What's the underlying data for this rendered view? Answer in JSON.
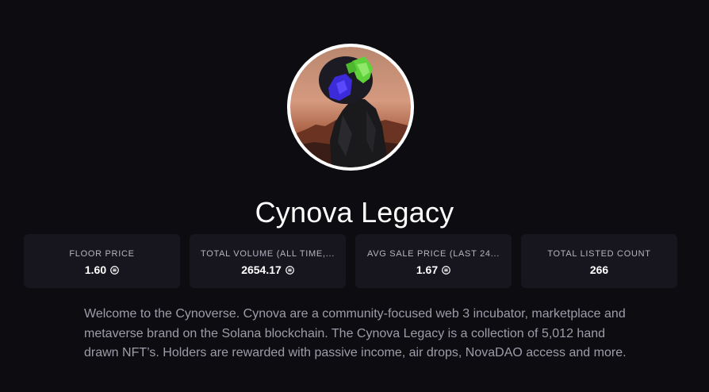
{
  "collection": {
    "name": "Cynova Legacy",
    "avatar_icon": "cynova-avatar-image"
  },
  "stats": [
    {
      "label": "FLOOR PRICE",
      "value": "1.60",
      "currency_icon": "solana-icon"
    },
    {
      "label": "TOTAL VOLUME (ALL TIME,...",
      "value": "2654.17",
      "currency_icon": "solana-icon"
    },
    {
      "label": "AVG SALE PRICE (LAST 24...",
      "value": "1.67",
      "currency_icon": "solana-icon"
    },
    {
      "label": "TOTAL LISTED COUNT",
      "value": "266"
    }
  ],
  "description": "Welcome to the Cynoverse. Cynova are a community-focused web 3 incubator, marketplace and metaverse brand on the Solana blockchain. The Cynova Legacy is a collection of 5,012 hand drawn NFT’s. Holders are rewarded with passive income, air drops, NovaDAO access and more.",
  "colors": {
    "background": "#0d0c10",
    "card": "#17161f",
    "label": "#b5b3c0",
    "body_text": "#9e9ca8",
    "accent_green": "#5fd13a",
    "accent_blue": "#3b2bd9"
  }
}
